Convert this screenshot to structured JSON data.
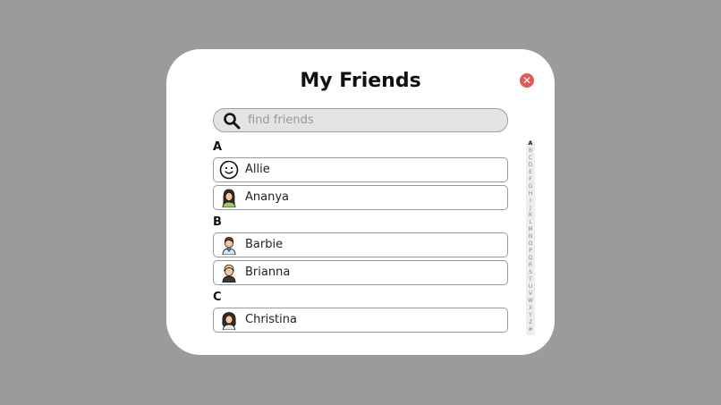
{
  "dialog": {
    "title": "My Friends",
    "close_icon": "close-icon"
  },
  "search": {
    "placeholder": "find friends",
    "icon": "search-icon"
  },
  "sections": [
    {
      "letter": "A",
      "friends": [
        {
          "name": "Allie",
          "avatar": "smiley-face-icon"
        },
        {
          "name": "Ananya",
          "avatar": "avatar-long-dark-hair-icon"
        }
      ]
    },
    {
      "letter": "B",
      "friends": [
        {
          "name": "Barbie",
          "avatar": "avatar-short-brown-hair-icon"
        },
        {
          "name": "Brianna",
          "avatar": "avatar-blonde-hair-icon"
        }
      ]
    },
    {
      "letter": "C",
      "friends": [
        {
          "name": "Christina",
          "avatar": "avatar-curly-hair-icon"
        }
      ]
    }
  ],
  "alphabet_index": [
    "A",
    "B",
    "C",
    "D",
    "E",
    "F",
    "G",
    "H",
    "I",
    "J",
    "K",
    "L",
    "M",
    "N",
    "O",
    "P",
    "Q",
    "R",
    "S",
    "T",
    "U",
    "V",
    "W",
    "X",
    "Y",
    "Z",
    "#"
  ],
  "alphabet_active": "A",
  "colors": {
    "backdrop": "#9b9b9b",
    "close_button": "#e05a57",
    "search_bg": "#e3e3e3"
  }
}
